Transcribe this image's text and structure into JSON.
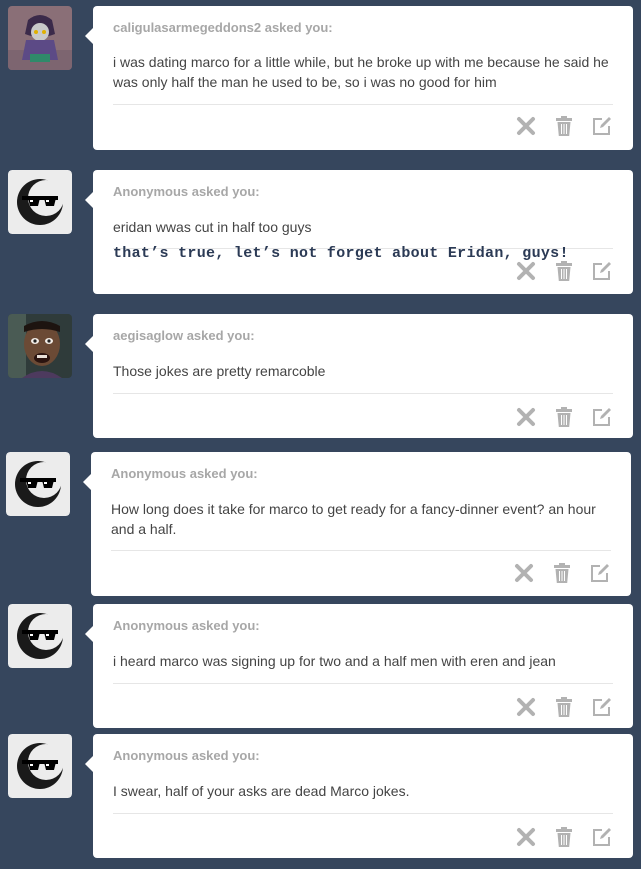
{
  "asks": [
    {
      "asker": "caligulasarmegeddons2 asked you:",
      "question": "i was dating marco for a little while, but he broke up with me because he said he was only half the man he used to be, so i was no good for him",
      "answer": ""
    },
    {
      "asker": "Anonymous asked you:",
      "question": "eridan wwas cut in half too guys",
      "answer": "that’s true, let’s not forget about Eridan, guys!"
    },
    {
      "asker": "aegisaglow asked you:",
      "question": "Those jokes are pretty remarcoble",
      "answer": ""
    },
    {
      "asker": "Anonymous asked you:",
      "question": "How long does it take for marco to get ready for a fancy-dinner event? an hour and a half.",
      "answer": ""
    },
    {
      "asker": "Anonymous asked you:",
      "question": "i heard marco was signing up for two and a half men with eren and jean",
      "answer": ""
    },
    {
      "asker": "Anonymous asked you:",
      "question": "I swear, half of your asks are dead Marco jokes.",
      "answer": ""
    }
  ],
  "icons": {
    "delete": "x-icon",
    "trash": "trash-icon",
    "answer": "edit-icon",
    "anonymous_avatar": "sunglasses-moon-avatar"
  },
  "colors": {
    "background": "#36465d",
    "action_icon": "#b2b2b2",
    "asker_text": "#a7a7a7"
  }
}
